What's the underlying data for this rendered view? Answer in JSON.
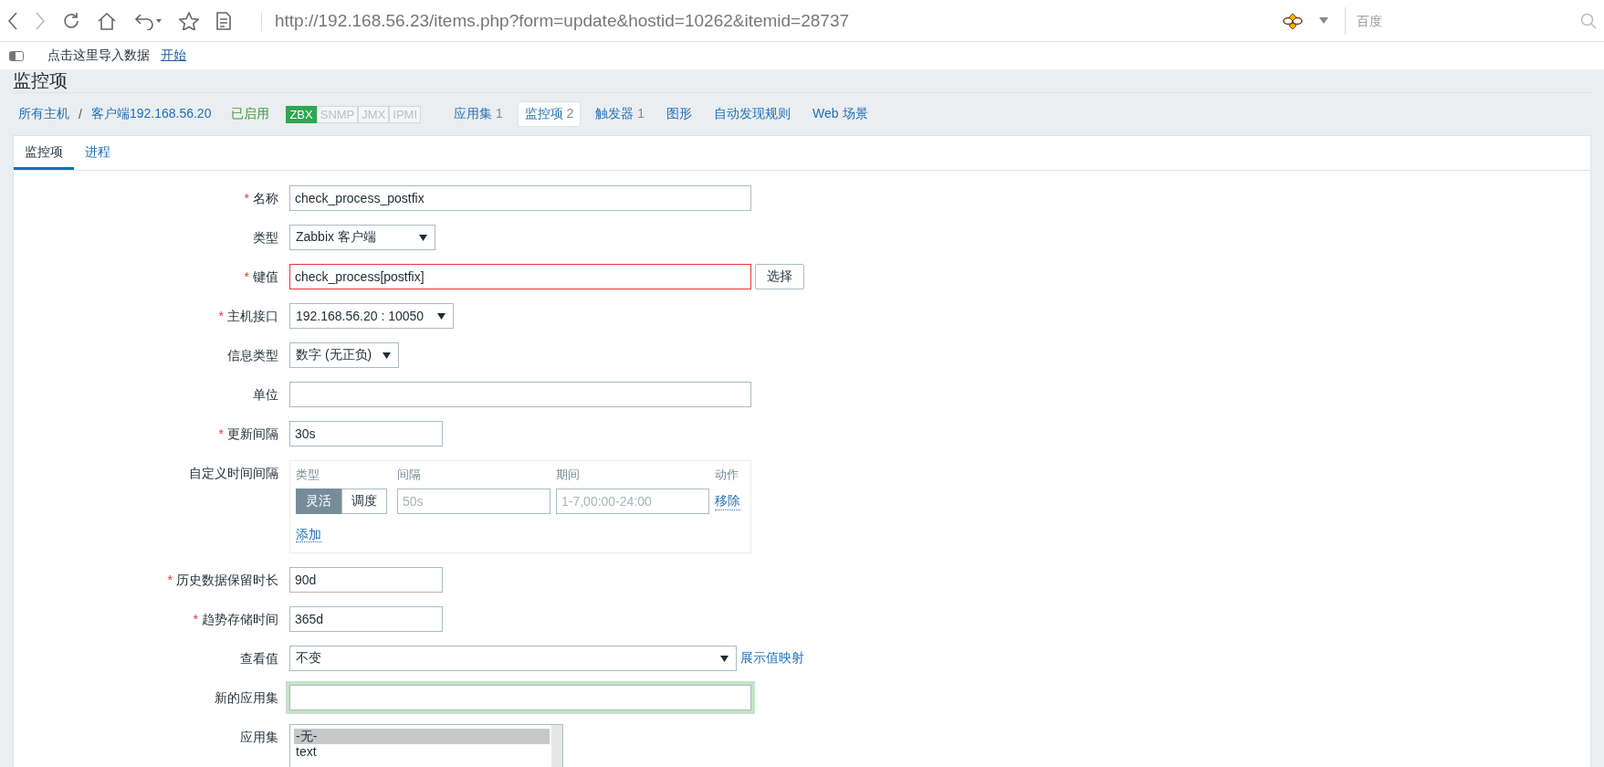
{
  "browser": {
    "url": "http://192.168.56.23/items.php?form=update&hostid=10262&itemid=28737",
    "search": {
      "placeholder": "百度"
    }
  },
  "bookmarks": {
    "import_text": "点击这里导入数据",
    "start_link": "开始"
  },
  "page_title": "监控项",
  "breadcrumb": {
    "items": [
      "所有主机",
      "客户端192.168.56.20"
    ],
    "separator": "/"
  },
  "status": "已启用",
  "availability": [
    {
      "label": "ZBX",
      "available": true
    },
    {
      "label": "SNMP",
      "available": false
    },
    {
      "label": "JMX",
      "available": false
    },
    {
      "label": "IPMI",
      "available": false
    }
  ],
  "host_tabs": [
    {
      "label": "应用集",
      "count": "1",
      "selected": false
    },
    {
      "label": "监控项",
      "count": "2",
      "selected": true
    },
    {
      "label": "触发器",
      "count": "1",
      "selected": false
    },
    {
      "label": "图形",
      "selected": false
    },
    {
      "label": "自动发现规则",
      "selected": false
    },
    {
      "label": "Web 场景",
      "selected": false
    }
  ],
  "form_tabs": [
    {
      "label": "监控项",
      "selected": true
    },
    {
      "label": "进程",
      "selected": false
    }
  ],
  "required_mark": "*",
  "fields": [
    {
      "kind": "text",
      "label": "名称",
      "required": true,
      "value": "check_process_postfix"
    },
    {
      "kind": "select",
      "label": "类型",
      "required": false,
      "value": "Zabbix 客户端"
    },
    {
      "kind": "text",
      "label": "键值",
      "required": true,
      "value": "check_process[postfix]",
      "highlighted": true,
      "button": "选择"
    },
    {
      "kind": "select",
      "label": "主机接口",
      "required": true,
      "value": "192.168.56.20 : 10050"
    },
    {
      "kind": "select",
      "label": "信息类型",
      "required": false,
      "value": "数字 (无正负)"
    },
    {
      "kind": "text",
      "label": "单位",
      "required": false
    },
    {
      "kind": "text",
      "label": "更新间隔",
      "required": true,
      "value": "30s"
    },
    {
      "kind": "intervals",
      "label": "自定义时间间隔",
      "required": false,
      "headers": [
        "类型",
        "间隔",
        "期间",
        "动作"
      ],
      "rows": [
        {
          "modes": [
            {
              "label": "灵活",
              "selected": true
            },
            {
              "label": "调度",
              "selected": false
            }
          ],
          "interval_placeholder": "50s",
          "period_placeholder": "1-7,00:00-24:00",
          "remove": "移除"
        }
      ],
      "add": "添加"
    },
    {
      "kind": "text",
      "label": "历史数据保留时长",
      "required": true,
      "value": "90d"
    },
    {
      "kind": "text",
      "label": "趋势存储时间",
      "required": true,
      "value": "365d"
    },
    {
      "kind": "select",
      "label": "查看值",
      "required": false,
      "value": "不变",
      "link": "展示值映射"
    },
    {
      "kind": "text",
      "label": "新的应用集",
      "required": false,
      "focused": true
    },
    {
      "kind": "listbox",
      "label": "应用集",
      "required": false,
      "options": [
        {
          "label": "-无-",
          "selected": true
        },
        {
          "label": "text",
          "selected": false
        }
      ]
    }
  ]
}
